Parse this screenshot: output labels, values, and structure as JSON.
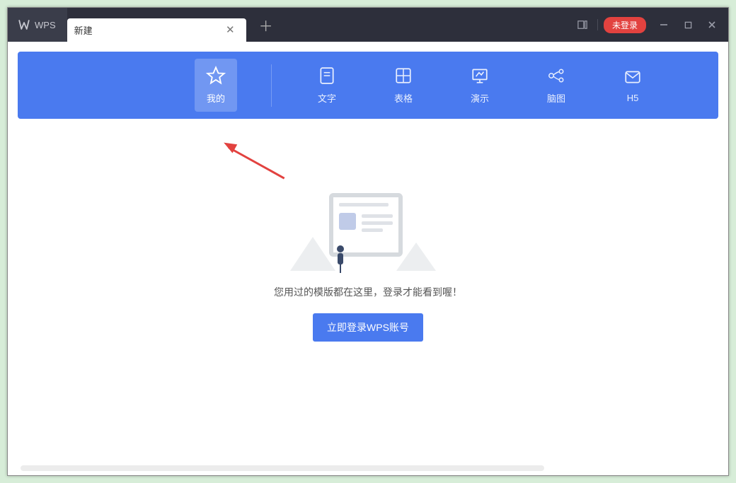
{
  "brand": {
    "label": "WPS"
  },
  "tab": {
    "title": "新建"
  },
  "window_controls": {
    "login_label": "未登录"
  },
  "categories": [
    {
      "key": "mine",
      "label": "我的",
      "icon": "star"
    },
    {
      "key": "writer",
      "label": "文字",
      "icon": "doc"
    },
    {
      "key": "sheet",
      "label": "表格",
      "icon": "grid"
    },
    {
      "key": "slides",
      "label": "演示",
      "icon": "chart"
    },
    {
      "key": "mind",
      "label": "脑图",
      "icon": "mind"
    },
    {
      "key": "h5",
      "label": "H5",
      "icon": "h5"
    }
  ],
  "active_category": "mine",
  "empty_state": {
    "message": "您用过的模版都在这里，登录才能看到喔！",
    "login_button": "立即登录WPS账号"
  },
  "colors": {
    "titlebar": "#2d2f3b",
    "accent": "#4a7aef",
    "danger": "#e2423f"
  }
}
